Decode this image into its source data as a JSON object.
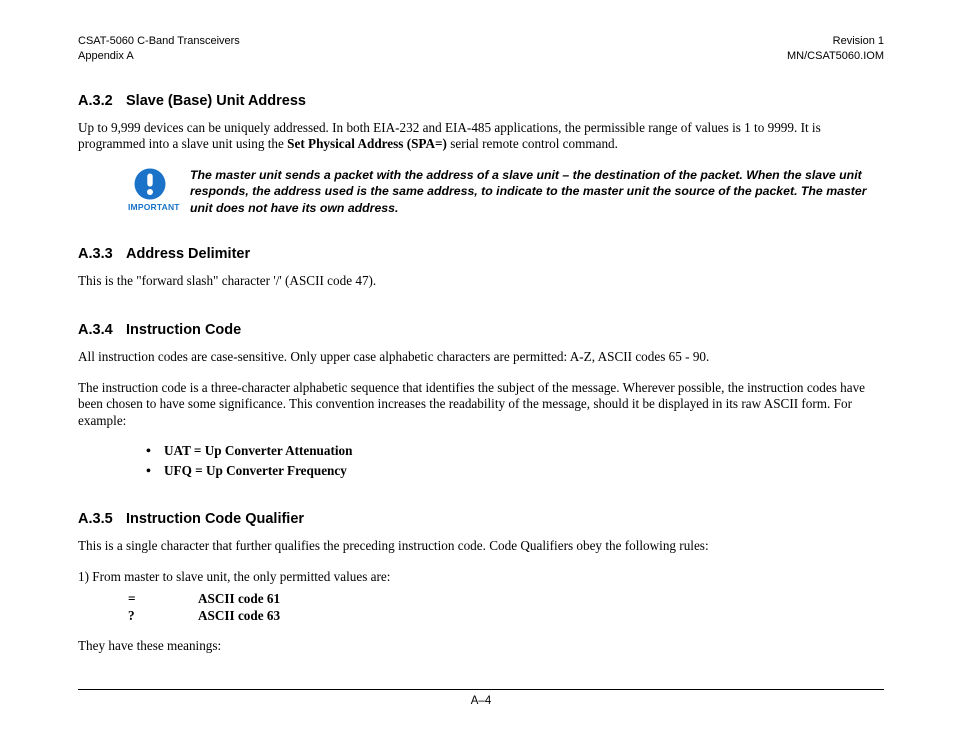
{
  "header": {
    "left_line1": "CSAT-5060 C-Band Transceivers",
    "left_line2": "Appendix A",
    "right_line1": "Revision 1",
    "right_line2": "MN/CSAT5060.IOM"
  },
  "sections": {
    "a32": {
      "num": "A.3.2",
      "title": "Slave (Base) Unit Address",
      "p1_a": "Up to 9,999 devices can be uniquely addressed. In both EIA-232 and EIA-485 applications, the permissible range of values is 1 to 9999. It is programmed into a slave unit using the ",
      "p1_bold": "Set Physical Address (SPA=)",
      "p1_b": " serial remote control command.",
      "important_label": "IMPORTANT",
      "callout": "The master unit sends a packet with the address of a slave unit – the destination of the packet. When the slave unit responds, the address used is the same address, to indicate to the master unit the source of the packet. The master unit does not have its own address."
    },
    "a33": {
      "num": "A.3.3",
      "title": "Address Delimiter",
      "p1": "This is the \"forward slash\" character '/' (ASCII code 47)."
    },
    "a34": {
      "num": "A.3.4",
      "title": "Instruction Code",
      "p1": "All instruction codes are case-sensitive. Only upper case alphabetic characters are permitted: A-Z, ASCII codes 65 - 90.",
      "p2": "The instruction code is a three-character alphabetic sequence that identifies the subject of the message. Wherever  possible, the instruction codes have been chosen to have some significance. This convention increases the readability of the message, should it be displayed in its raw ASCII form.  For example:",
      "bullets": [
        "UAT = Up Converter Attenuation",
        "UFQ = Up Converter Frequency"
      ]
    },
    "a35": {
      "num": "A.3.5",
      "title": "Instruction Code Qualifier",
      "p1": "This is a single character that further qualifies the preceding instruction code. Code Qualifiers obey the following rules:",
      "ol1": "1)   From master to slave unit, the only permitted values are:",
      "codes": [
        {
          "sym": "=",
          "desc": "ASCII code 61"
        },
        {
          "sym": "?",
          "desc": "ASCII code 63"
        }
      ],
      "p2": "They have these meanings:"
    }
  },
  "footer": {
    "page": "A–4"
  }
}
